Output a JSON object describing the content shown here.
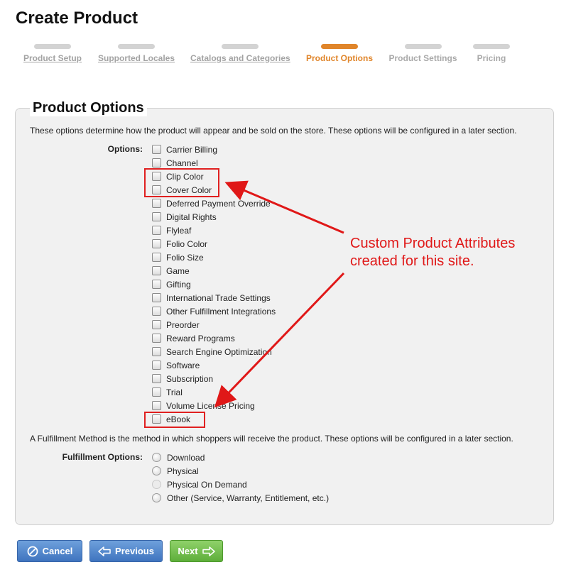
{
  "page": {
    "title": "Create Product"
  },
  "wizard": {
    "steps": [
      {
        "label": "Product Setup",
        "state": "done"
      },
      {
        "label": "Supported Locales",
        "state": "done"
      },
      {
        "label": "Catalogs and Categories",
        "state": "done"
      },
      {
        "label": "Product Options",
        "state": "active"
      },
      {
        "label": "Product Settings",
        "state": "future"
      },
      {
        "label": "Pricing",
        "state": "future"
      }
    ],
    "active_color": "#e0852a"
  },
  "panel": {
    "legend": "Product Options",
    "options_description": "These options determine how the product will appear and be sold on the store. These options will be configured in a later section.",
    "options_label": "Options:",
    "options": [
      "Carrier Billing",
      "Channel",
      "Clip Color",
      "Cover Color",
      "Deferred Payment Override",
      "Digital Rights",
      "Flyleaf",
      "Folio Color",
      "Folio Size",
      "Game",
      "Gifting",
      "International Trade Settings",
      "Other Fulfillment Integrations",
      "Preorder",
      "Reward Programs",
      "Search Engine Optimization",
      "Software",
      "Subscription",
      "Trial",
      "Volume License Pricing",
      "eBook"
    ],
    "fulfillment_description": "A Fulfillment Method is the method in which shoppers will receive the product. These options will be configured in a later section.",
    "fulfillment_label": "Fulfillment Options:",
    "fulfillment_options": [
      {
        "label": "Download",
        "disabled": false
      },
      {
        "label": "Physical",
        "disabled": false
      },
      {
        "label": "Physical On Demand",
        "disabled": true
      },
      {
        "label": "Other (Service, Warranty, Entitlement, etc.)",
        "disabled": false
      }
    ]
  },
  "annotation": {
    "line1": "Custom Product Attributes",
    "line2": "created for this site.",
    "color": "#e01818"
  },
  "buttons": {
    "cancel": "Cancel",
    "previous": "Previous",
    "next": "Next"
  }
}
